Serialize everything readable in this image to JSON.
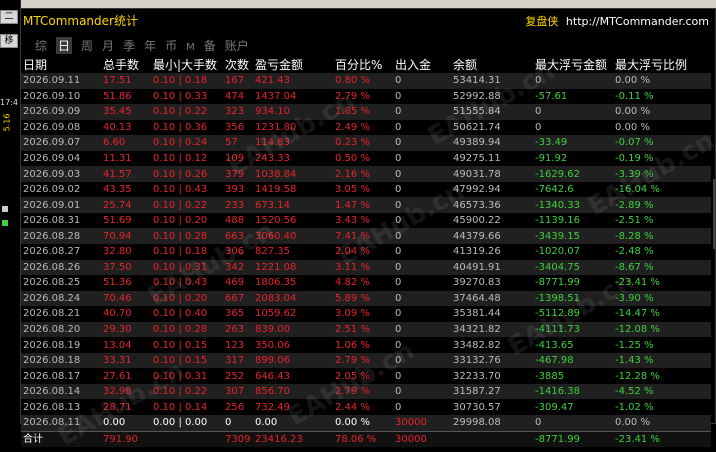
{
  "window": {
    "title": "MTCommander统计",
    "site_label": "复盘侠",
    "site_url": "http://MTCommander.com"
  },
  "background": {
    "left_labels": [
      "二",
      "移",
      "17:4",
      "5.16"
    ],
    "top_hint": ""
  },
  "tabs": [
    "综",
    "日",
    "周",
    "月",
    "季",
    "年",
    "币",
    "M",
    "备",
    "账户"
  ],
  "active_tab": "日",
  "watermark": "EAHub.cn",
  "columns": [
    "日期",
    "总手数",
    "最小|大手数",
    "次数",
    "盈亏金额",
    "百分比%",
    "出入金",
    "余额",
    "最大浮亏金额",
    "最大浮亏比例"
  ],
  "rows": [
    [
      "2026.09.11",
      "17.51",
      "0.10 | 0.18",
      "167",
      "421.43",
      "0.80 %",
      "0",
      "53414.31",
      "0",
      "0.00 %"
    ],
    [
      "2026.09.10",
      "51.86",
      "0.10 | 0.33",
      "474",
      "1437.04",
      "2.79 %",
      "0",
      "52992.88",
      "-57.61",
      "-0.11 %"
    ],
    [
      "2026.09.09",
      "35.45",
      "0.10 | 0.22",
      "323",
      "934.10",
      "1.85 %",
      "0",
      "51555.84",
      "0",
      "0.00 %"
    ],
    [
      "2026.09.08",
      "40.13",
      "0.10 | 0.36",
      "356",
      "1231.80",
      "2.49 %",
      "0",
      "50621.74",
      "0",
      "0.00 %"
    ],
    [
      "2026.09.07",
      "6.60",
      "0.10 | 0.24",
      "57",
      "114.83",
      "0.23 %",
      "0",
      "49389.94",
      "-33.49",
      "-0.07 %"
    ],
    [
      "2026.09.04",
      "11.31",
      "0.10 | 0.12",
      "109",
      "243.33",
      "0.50 %",
      "0",
      "49275.11",
      "-91.92",
      "-0.19 %"
    ],
    [
      "2026.09.03",
      "41.57",
      "0.10 | 0.26",
      "379",
      "1038.84",
      "2.16 %",
      "0",
      "49031.78",
      "-1629.62",
      "-3.39 %"
    ],
    [
      "2026.09.02",
      "43.35",
      "0.10 | 0.43",
      "393",
      "1419.58",
      "3.05 %",
      "0",
      "47992.94",
      "-7642.6",
      "-16.04 %"
    ],
    [
      "2026.09.01",
      "25.74",
      "0.10 | 0.22",
      "233",
      "673.14",
      "1.47 %",
      "0",
      "46573.36",
      "-1340.33",
      "-2.89 %"
    ],
    [
      "2026.08.31",
      "51.69",
      "0.10 | 0.20",
      "488",
      "1520.56",
      "3.43 %",
      "0",
      "45900.22",
      "-1139.16",
      "-2.51 %"
    ],
    [
      "2026.08.28",
      "70.94",
      "0.10 | 0.28",
      "663",
      "3060.40",
      "7.41 %",
      "0",
      "44379.66",
      "-3439.15",
      "-8.28 %"
    ],
    [
      "2026.08.27",
      "32.80",
      "0.10 | 0.18",
      "306",
      "827.35",
      "2.04 %",
      "0",
      "41319.26",
      "-1020.07",
      "-2.48 %"
    ],
    [
      "2026.08.26",
      "37.50",
      "0.10 | 0.31",
      "342",
      "1221.08",
      "3.11 %",
      "0",
      "40491.91",
      "-3404.75",
      "-8.67 %"
    ],
    [
      "2026.08.25",
      "51.36",
      "0.10 | 0.43",
      "469",
      "1806.35",
      "4.82 %",
      "0",
      "39270.83",
      "-8771.99",
      "-23.41 %"
    ],
    [
      "2026.08.24",
      "70.46",
      "0.10 | 0.20",
      "667",
      "2083.04",
      "5.89 %",
      "0",
      "37464.48",
      "-1398.51",
      "-3.90 %"
    ],
    [
      "2026.08.21",
      "40.70",
      "0.10 | 0.40",
      "365",
      "1059.62",
      "3.09 %",
      "0",
      "35381.44",
      "-5112.89",
      "-14.47 %"
    ],
    [
      "2026.08.20",
      "29.30",
      "0.10 | 0.28",
      "263",
      "839.00",
      "2.51 %",
      "0",
      "34321.82",
      "-4111.73",
      "-12.08 %"
    ],
    [
      "2026.08.19",
      "13.04",
      "0.10 | 0.15",
      "123",
      "350.06",
      "1.06 %",
      "0",
      "33482.82",
      "-413.65",
      "-1.25 %"
    ],
    [
      "2026.08.18",
      "33.31",
      "0.10 | 0.15",
      "317",
      "899.06",
      "2.79 %",
      "0",
      "33132.76",
      "-467.98",
      "-1.43 %"
    ],
    [
      "2026.08.17",
      "27.61",
      "0.10 | 0.31",
      "252",
      "646.43",
      "2.05 %",
      "0",
      "32233.70",
      "-3885",
      "-12.28 %"
    ],
    [
      "2026.08.14",
      "32.98",
      "0.10 | 0.22",
      "307",
      "856.70",
      "2.79 %",
      "0",
      "31587.27",
      "-1416.38",
      "-4.52 %"
    ],
    [
      "2026.08.13",
      "28.71",
      "0.10 | 0.14",
      "256",
      "732.49",
      "2.44 %",
      "0",
      "30730.57",
      "-309.47",
      "-1.02 %"
    ],
    [
      "2026.08.11",
      "0.00",
      "0.00 | 0.00",
      "0",
      "0.00",
      "0.00 %",
      "30000",
      "29998.08",
      "0",
      "0.00 %"
    ]
  ],
  "total": [
    "合计",
    "791.90",
    "",
    "7309",
    "23416.23",
    "78.06 %",
    "30000",
    "",
    "-8771.99",
    "-23.41 %"
  ],
  "colors": {
    "title": "#ffd700",
    "profit": "#e8232a",
    "drawdown": "#3ecf3e",
    "header": "#ffffff"
  }
}
